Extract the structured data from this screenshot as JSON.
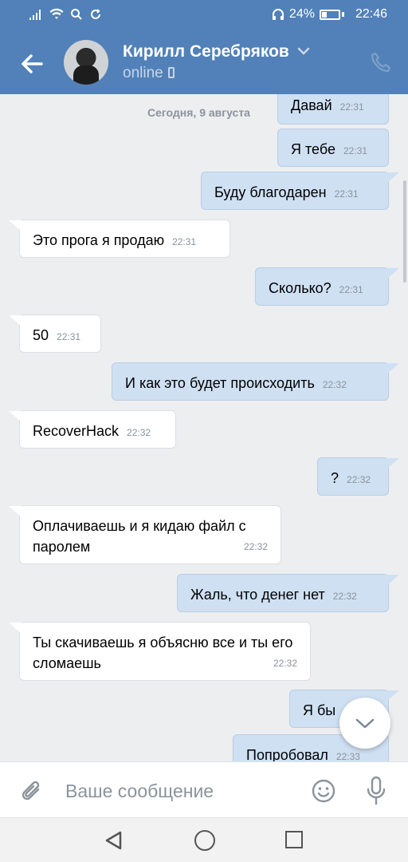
{
  "status_bar": {
    "left_icons": [
      "signal-icon",
      "wifi-icon",
      "search-icon",
      "sync-icon"
    ],
    "battery_percent": "24%",
    "time": "22:46"
  },
  "header": {
    "contact_name": "Кирилл Серебряков",
    "contact_status": "online",
    "accent_color": "#5181b8"
  },
  "chat": {
    "date_label": "Сегодня, 9 августа",
    "messages": [
      {
        "dir": "out",
        "text": "Давай",
        "time": "22:31"
      },
      {
        "dir": "out",
        "text": "Я тебе",
        "time": "22:31"
      },
      {
        "dir": "out",
        "text": "Буду благодарен",
        "time": "22:31"
      },
      {
        "dir": "in",
        "text": "Это прога я продаю",
        "time": "22:31"
      },
      {
        "dir": "out",
        "text": "Сколько?",
        "time": "22:31"
      },
      {
        "dir": "in",
        "text": "50",
        "time": "22:31"
      },
      {
        "dir": "out",
        "text": "И как это будет происходить",
        "time": "22:32"
      },
      {
        "dir": "in",
        "text": "RecoverHack",
        "time": "22:32"
      },
      {
        "dir": "out",
        "text": "?",
        "time": "22:32"
      },
      {
        "dir": "in",
        "text": "Оплачиваешь и я кидаю файл с паролем",
        "time": "22:32"
      },
      {
        "dir": "out",
        "text": "Жаль, что денег нет",
        "time": "22:32"
      },
      {
        "dir": "in",
        "text": "Ты скачиваешь я объясню все и ты его сломаешь",
        "time": "22:32"
      },
      {
        "dir": "out",
        "text": "Я бы",
        "time": ""
      },
      {
        "dir": "out",
        "text": "Попробовал",
        "time": "22:33"
      }
    ]
  },
  "composer": {
    "placeholder": "Ваше сообщение"
  },
  "colors": {
    "outgoing_bubble": "#cfe0f3",
    "incoming_bubble": "#ffffff",
    "chat_background": "#edeef0"
  }
}
